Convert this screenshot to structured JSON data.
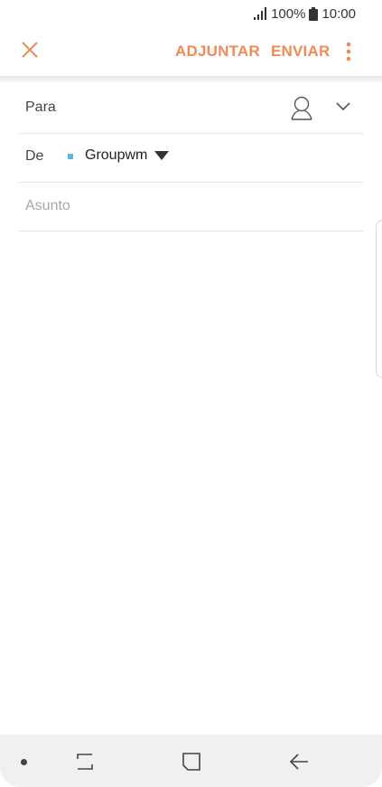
{
  "status_bar": {
    "battery": "100%",
    "time": "10:00",
    "icons": [
      "signal-icon",
      "battery-icon"
    ]
  },
  "toolbar": {
    "close_icon": "close-icon",
    "attach_label": "ADJUNTAR",
    "send_label": "ENVIAR",
    "more_icon": "more-vertical-icon",
    "accent_color": "#f08a56"
  },
  "compose": {
    "to_label": "Para",
    "to_icons": [
      "contact-icon",
      "chevron-down-icon"
    ],
    "from_label": "De",
    "from_account": "Groupwm",
    "account_color": "#5bb6e0",
    "subject_placeholder": "Asunto",
    "subject_value": "",
    "body_value": ""
  },
  "nav_bar": {
    "buttons": [
      "recents-icon",
      "home-icon",
      "back-icon"
    ]
  }
}
